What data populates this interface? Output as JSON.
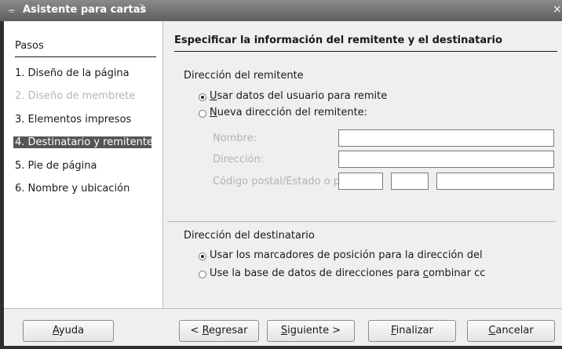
{
  "window": {
    "title": "Asistente para cartas"
  },
  "sidebar": {
    "heading": "Pasos",
    "steps": [
      {
        "label": "1. Diseño de la página"
      },
      {
        "label": "2. Diseño de membrete"
      },
      {
        "label": "3. Elementos impresos"
      },
      {
        "label": "4. Destinatario y remitente"
      },
      {
        "label": "5. Pie de página"
      },
      {
        "label": "6. Nombre y ubicación"
      }
    ]
  },
  "main": {
    "heading": "Especificar la información del remitente y el destinatario",
    "sender": {
      "label": "Dirección del remitente",
      "option_user_pre": "",
      "option_user_mnemonic": "U",
      "option_user_rest": "sar datos del usuario para remite",
      "option_new_mnemonic": "N",
      "option_new_rest": "ueva dirección del remitente:",
      "name_label": "Nombre:",
      "address_label": "Dirección:",
      "postal_label": "Código postal/Estado o pr",
      "name_value": "",
      "address_value": "",
      "postal_value": "",
      "state_value": "",
      "city_value": ""
    },
    "recipient": {
      "label": "Dirección del destinatario",
      "option_placeholders": "Usar los marcadores de posición para la dirección del",
      "option_db_pre": "Use la base de datos de direcciones para ",
      "option_db_mnemonic": "c",
      "option_db_rest": "ombinar cc"
    }
  },
  "buttons": {
    "help_mnemonic": "A",
    "help_rest": "yuda",
    "back_pre": "< ",
    "back_mnemonic": "R",
    "back_rest": "egresar",
    "next_mnemonic": "S",
    "next_rest": "iguiente >",
    "finish_mnemonic": "F",
    "finish_rest": "inalizar",
    "cancel_mnemonic": "C",
    "cancel_rest": "ancelar"
  }
}
